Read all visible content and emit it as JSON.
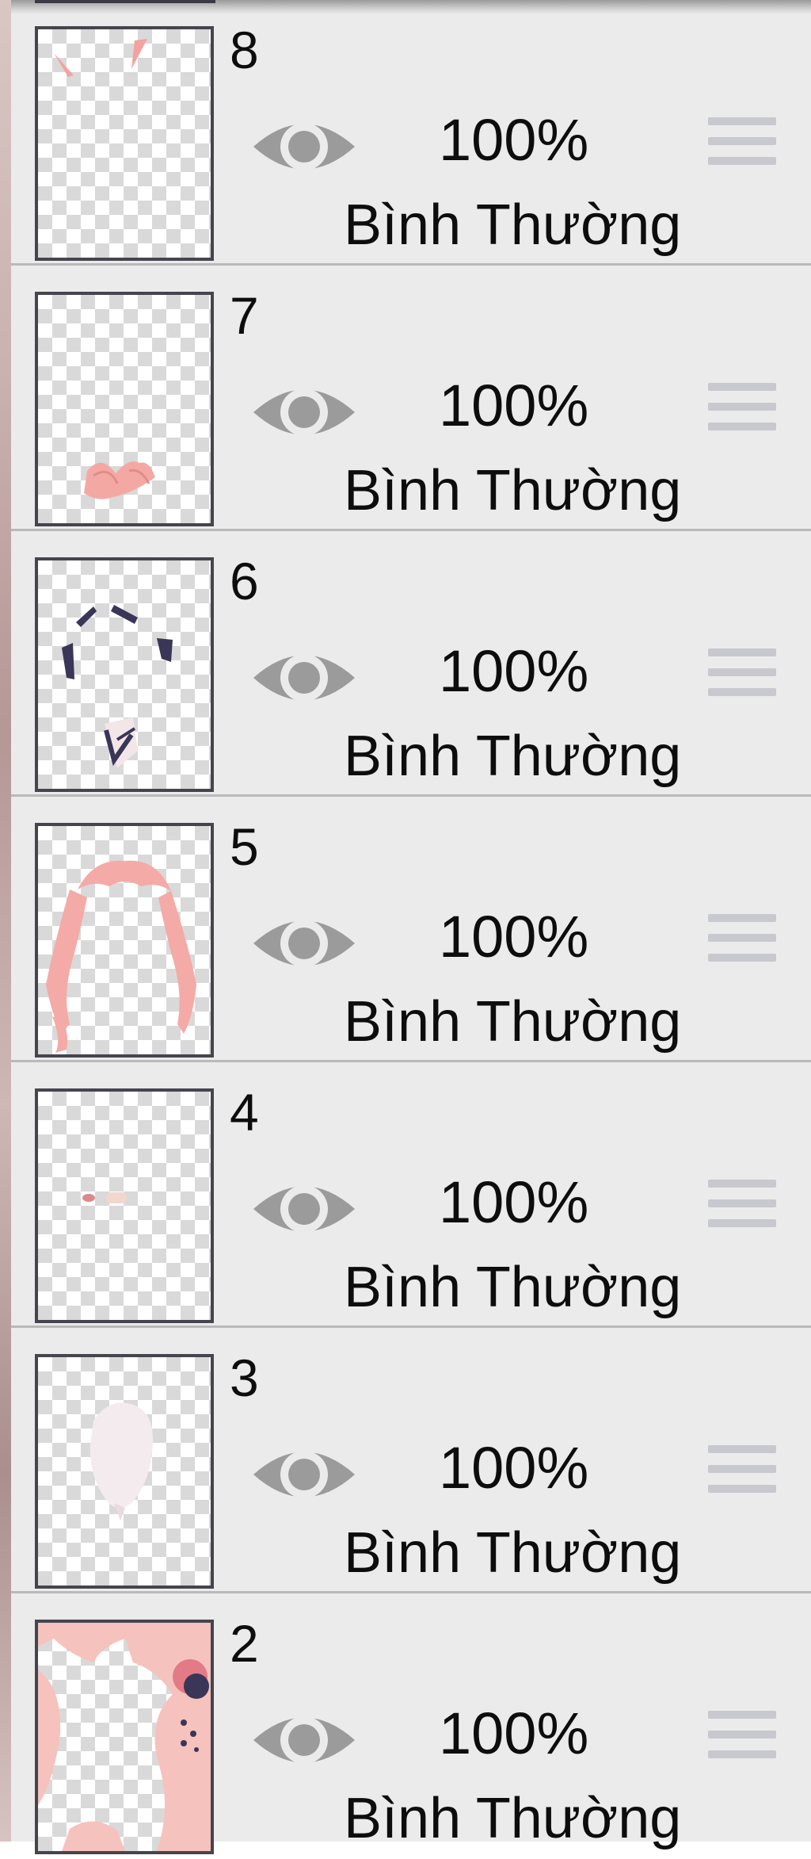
{
  "layers": [
    {
      "number": "8",
      "opacity": "100%",
      "blend": "Bình Thường"
    },
    {
      "number": "7",
      "opacity": "100%",
      "blend": "Bình Thường"
    },
    {
      "number": "6",
      "opacity": "100%",
      "blend": "Bình Thường"
    },
    {
      "number": "5",
      "opacity": "100%",
      "blend": "Bình Thường"
    },
    {
      "number": "4",
      "opacity": "100%",
      "blend": "Bình Thường"
    },
    {
      "number": "3",
      "opacity": "100%",
      "blend": "Bình Thường"
    },
    {
      "number": "2",
      "opacity": "100%",
      "blend": "Bình Thường"
    }
  ],
  "icons": {
    "visibility": "eye-icon",
    "reorder": "drag-handle-icon"
  },
  "colors": {
    "panel_bg": "#ebebeb",
    "eye": "#9b9b9b",
    "handle": "#c8c8cf",
    "thumb_border": "#45454f"
  }
}
